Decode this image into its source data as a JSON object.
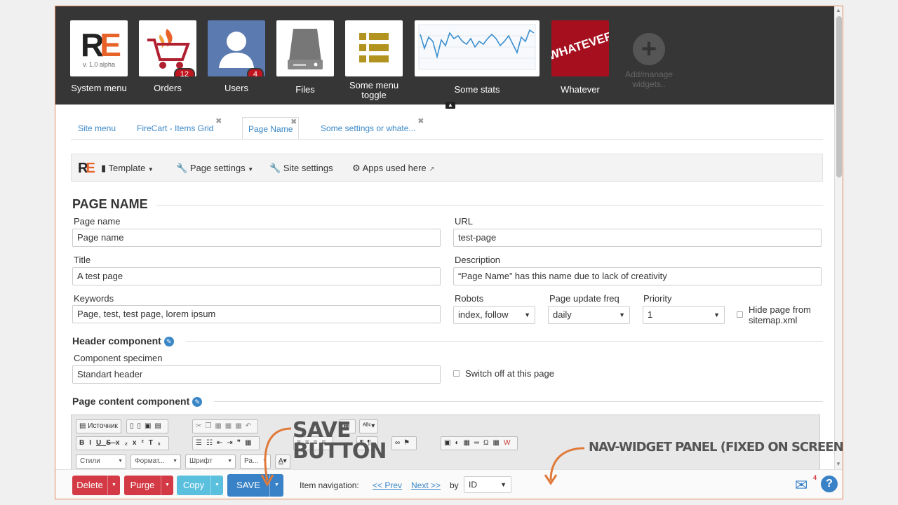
{
  "widgets": [
    {
      "caption": "System menu",
      "logo_text": "RE",
      "version": "v. 1.0 alpha"
    },
    {
      "caption": "Orders",
      "badge": "12"
    },
    {
      "caption": "Users",
      "badge": "4"
    },
    {
      "caption": "Files"
    },
    {
      "caption_line1": "Some menu",
      "caption_line2": "toggle"
    },
    {
      "caption": "Some stats"
    },
    {
      "caption": "Whatever",
      "tile_text": "WHATEVER"
    },
    {
      "caption_line1": "Add/manage",
      "caption_line2": "widgets.."
    }
  ],
  "tabs": [
    {
      "label": "Site menu"
    },
    {
      "label": "FireCart - Items Grid"
    },
    {
      "label": "Page Name"
    },
    {
      "label": "Some settings or whate..."
    }
  ],
  "toolbar": {
    "logo": "RE",
    "template": "Template",
    "page_settings": "Page settings",
    "site_settings": "Site settings",
    "apps_used": "Apps used here"
  },
  "form": {
    "section_title": "PAGE NAME",
    "page_name_label": "Page name",
    "page_name_value": "Page name",
    "url_label": "URL",
    "url_value": "test-page",
    "title_label": "Title",
    "title_value": "A test page",
    "description_label": "Description",
    "description_value": "“Page Name” has this name due to lack of creativity",
    "keywords_label": "Keywords",
    "keywords_value": "Page, test, test page, lorem ipsum",
    "robots_label": "Robots",
    "robots_value": "index, follow",
    "freq_label": "Page update freq",
    "freq_value": "daily",
    "priority_label": "Priority",
    "priority_value": "1",
    "hide_line1": "Hide page from",
    "hide_line2": "sitemap.xml",
    "header_component_title": "Header component",
    "component_specimen_label": "Component specimen",
    "component_specimen_value": "Standart header",
    "switch_off_label": "Switch off at this page",
    "page_content_title": "Page content component"
  },
  "editor": {
    "source": "Источник",
    "styles": "Стили",
    "format": "Формат...",
    "font": "Шрифт",
    "size": "Ра..."
  },
  "nav": {
    "delete": "Delete",
    "purge": "Purge",
    "copy": "Copy",
    "save": "SAVE",
    "item_navigation": "Item navigation:",
    "prev": "<< Prev",
    "next": "Next >>",
    "by": "by",
    "by_value": "ID",
    "mail_count": "4",
    "help": "?"
  },
  "annotations": {
    "save_line1": "SAVE",
    "save_line2": "BUTTON",
    "nav_panel": "NAV-WIDGET PANEL (FIXED ON SCREEN)"
  },
  "colors": {
    "accent": "#e8632a",
    "link": "#3a87c7",
    "danger": "#d33a45",
    "info": "#5bc0de",
    "primary": "#3a82c7",
    "panel": "#363636"
  }
}
